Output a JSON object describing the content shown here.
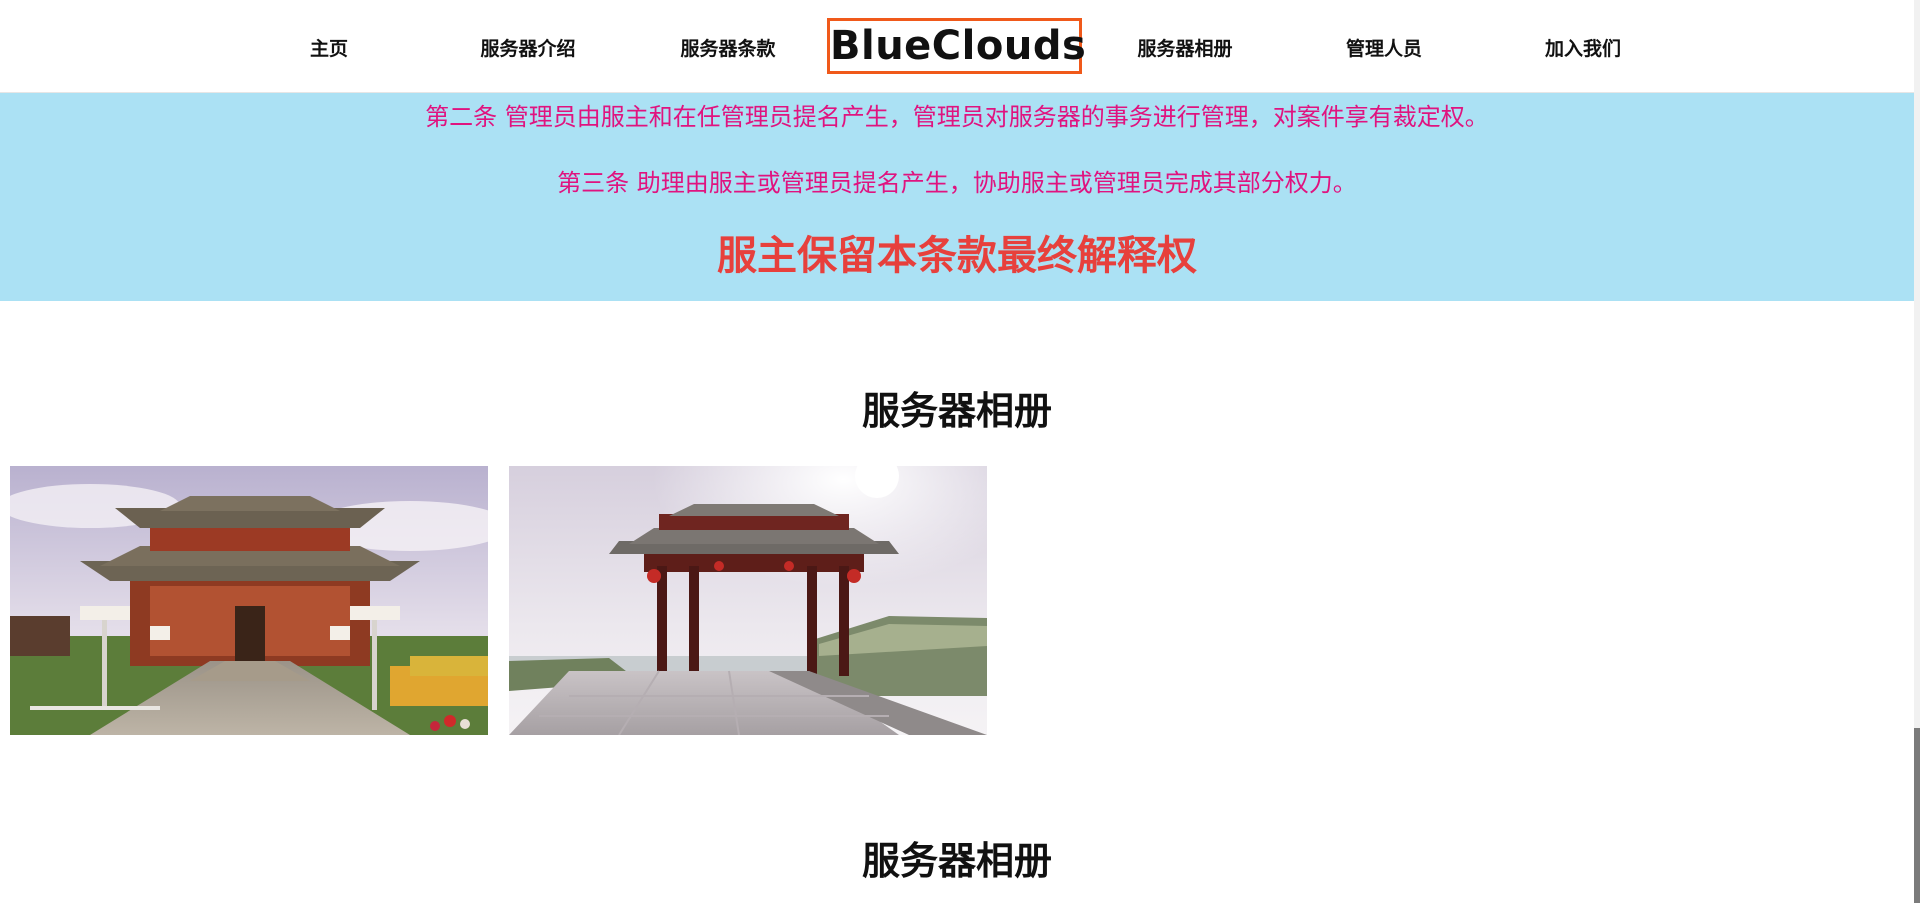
{
  "nav": {
    "home": "主页",
    "intro": "服务器介绍",
    "terms": "服务器条款",
    "logo": "BlueClouds",
    "album": "服务器相册",
    "admins": "管理人员",
    "join": "加入我们"
  },
  "terms": {
    "article2": "第二条  管理员由服主和在任管理员提名产生，管理员对服务器的事务进行管理，对案件享有裁定权。",
    "article3": "第三条  助理由服主或管理员提名产生，协助服主或管理员完成其部分权力。",
    "final": "服主保留本条款最终解释权"
  },
  "gallery": {
    "title1": "服务器相册",
    "title2": "服务器相册",
    "photos": [
      "temple-photo",
      "archway-photo"
    ]
  },
  "colors": {
    "terms_bg": "#abe1f4",
    "terms_text": "#e0137f",
    "final_text": "#e7403c",
    "logo_border": "#f0591a"
  }
}
